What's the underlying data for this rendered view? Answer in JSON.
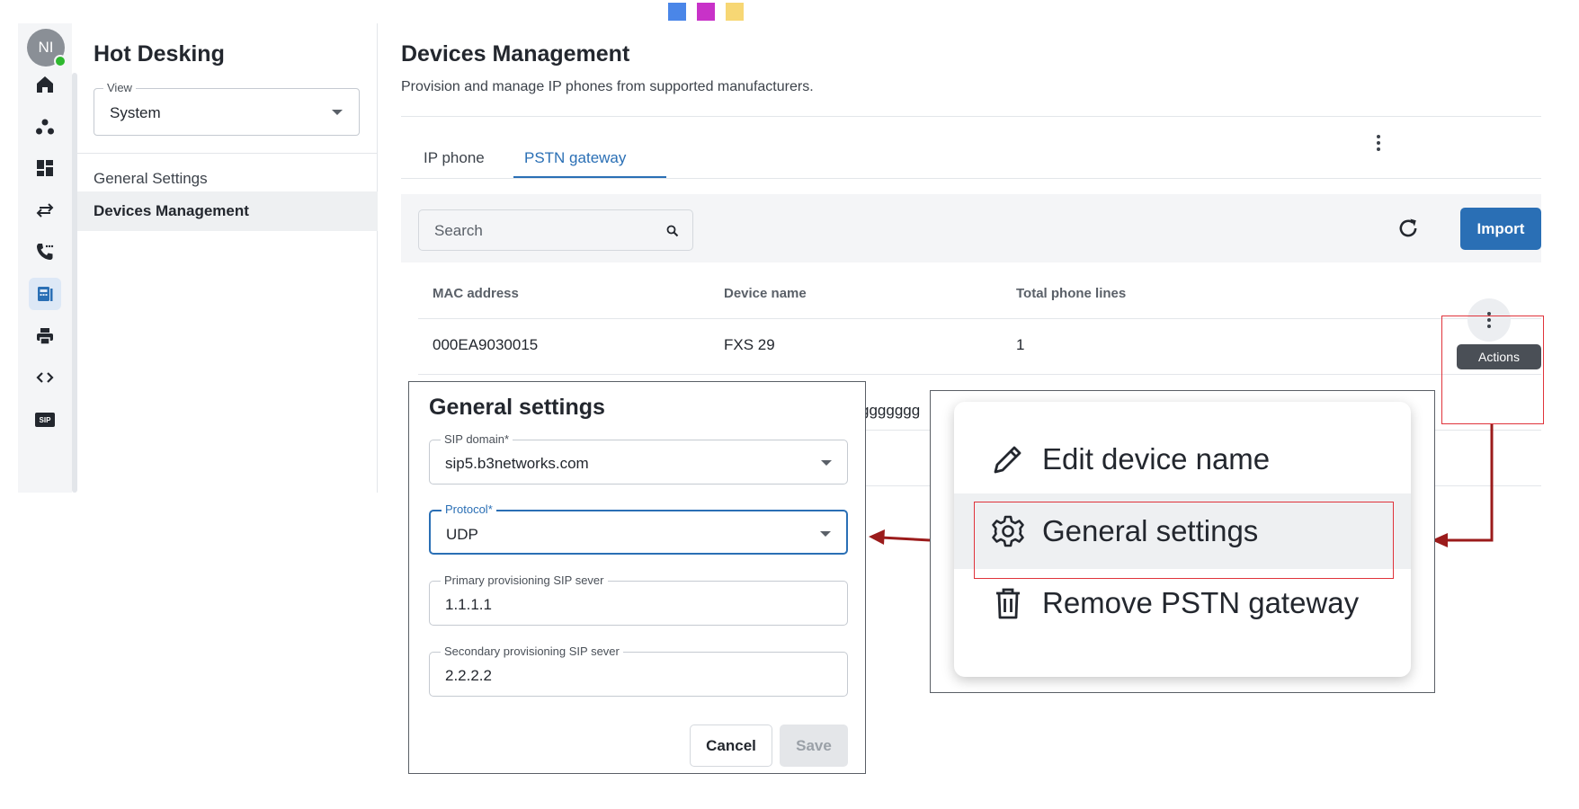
{
  "colors": {
    "accent": "#2a6fb5",
    "highlight_red": "#e0333b",
    "arrow": "#9b1b1b",
    "deco_blue": "#4a86e8",
    "deco_magenta": "#c832c8",
    "deco_yellow": "#f7d774"
  },
  "avatar": {
    "initials": "NI",
    "status": "online"
  },
  "rail_icons": [
    "home-icon",
    "contacts-icon",
    "dashboard-icon",
    "transfer-icon",
    "phone-icon",
    "devices-icon",
    "printer-icon",
    "code-icon",
    "sip-icon"
  ],
  "rail_sip_label": "SIP",
  "sidebar": {
    "title": "Hot Desking",
    "view": {
      "legend": "View",
      "value": "System"
    },
    "items": [
      {
        "label": "General Settings",
        "active": false
      },
      {
        "label": "Devices Management",
        "active": true
      }
    ]
  },
  "main": {
    "title": "Devices Management",
    "description": "Provision and manage IP phones from supported manufacturers.",
    "tabs": [
      {
        "label": "IP phone",
        "active": false
      },
      {
        "label": "PSTN gateway",
        "active": true
      }
    ],
    "search_placeholder": "Search",
    "import_label": "Import",
    "table": {
      "columns": [
        "MAC address",
        "Device name",
        "Total phone lines"
      ],
      "rows": [
        {
          "mac": "000EA9030015",
          "device_name": "FXS 29",
          "lines": "1"
        }
      ],
      "partial_row_text": "ggggggg"
    },
    "actions_tooltip": "Actions"
  },
  "dialog": {
    "title": "General settings",
    "fields": [
      {
        "legend": "SIP domain*",
        "value": "sip5.b3networks.com",
        "type": "select",
        "focused": false
      },
      {
        "legend": "Protocol*",
        "value": "UDP",
        "type": "select",
        "focused": true
      },
      {
        "legend": "Primary provisioning SIP sever",
        "value": "1.1.1.1",
        "type": "text",
        "focused": false
      },
      {
        "legend": "Secondary provisioning SIP sever",
        "value": "2.2.2.2",
        "type": "text",
        "focused": false
      }
    ],
    "cancel_label": "Cancel",
    "save_label": "Save",
    "save_enabled": false
  },
  "action_menu": {
    "items": [
      {
        "label": "Edit device name",
        "icon": "pencil-icon"
      },
      {
        "label": "General settings",
        "icon": "gear-icon",
        "highlighted": true
      },
      {
        "label": "Remove PSTN gateway",
        "icon": "trash-icon"
      }
    ]
  }
}
